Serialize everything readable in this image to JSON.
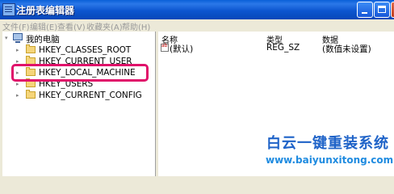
{
  "window": {
    "title": "注册表编辑器"
  },
  "menu": [
    "文件(F)",
    "编辑(E)",
    "查看(V)",
    "收藏夹(A)",
    "帮助(H)"
  ],
  "tree": {
    "root": "我的电脑",
    "items": [
      {
        "label": "HKEY_CLASSES_ROOT",
        "expander": "⊞"
      },
      {
        "label": "HKEY_CURRENT_USER",
        "expander": "⊞"
      },
      {
        "label": "HKEY_LOCAL_MACHINE",
        "expander": "⊞",
        "highlighted": true
      },
      {
        "label": "HKEY_USERS",
        "expander": "⊞"
      },
      {
        "label": "HKEY_CURRENT_CONFIG",
        "expander": "⊞"
      }
    ],
    "highlight_color": "#e0116a"
  },
  "list": {
    "columns": [
      "名称",
      "类型",
      "数据"
    ],
    "rows": [
      {
        "name": "(默认)",
        "type": "REG_SZ",
        "data": "(数值未设置)"
      }
    ]
  },
  "watermark": {
    "title": "白云一键重装系统",
    "url": "www.baiyunxitong.com"
  },
  "colors": {
    "titlebar": "#0a5fd8",
    "watermark": "#1f63c8"
  }
}
